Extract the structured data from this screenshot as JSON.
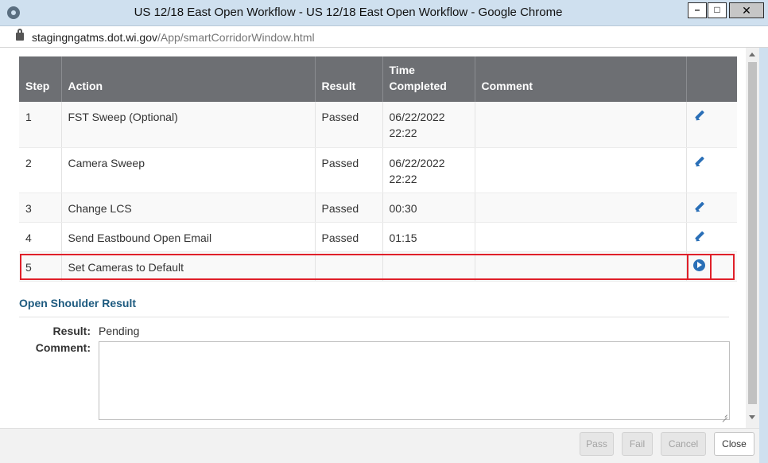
{
  "window": {
    "title": "US 12/18 East Open Workflow - US 12/18 East Open Workflow - Google Chrome",
    "minimize_glyph": "–",
    "maximize_glyph": "□",
    "close_glyph": "✕"
  },
  "address": {
    "host": "stagingngatms.dot.wi.gov",
    "path": "/App/smartCorridorWindow.html"
  },
  "table": {
    "headers": {
      "step": "Step",
      "action": "Action",
      "result": "Result",
      "time_completed_line1": "Time",
      "time_completed_line2": "Completed",
      "comment": "Comment",
      "icon": ""
    },
    "rows": [
      {
        "step": "1",
        "action": "FST Sweep (Optional)",
        "result": "Passed",
        "time_line1": "06/22/2022",
        "time_line2": "22:22",
        "comment": "",
        "icon": "edit-pencil-icon"
      },
      {
        "step": "2",
        "action": "Camera Sweep",
        "result": "Passed",
        "time_line1": "06/22/2022",
        "time_line2": "22:22",
        "comment": "",
        "icon": "edit-pencil-icon"
      },
      {
        "step": "3",
        "action": "Change LCS",
        "result": "Passed",
        "time_line1": "00:30",
        "time_line2": "",
        "comment": "",
        "icon": "edit-pencil-icon"
      },
      {
        "step": "4",
        "action": "Send Eastbound Open Email",
        "result": "Passed",
        "time_line1": "01:15",
        "time_line2": "",
        "comment": "",
        "icon": "edit-pencil-icon"
      },
      {
        "step": "5",
        "action": "Set Cameras to Default",
        "result": "",
        "time_line1": "",
        "time_line2": "",
        "comment": "",
        "icon": "play-circle-icon"
      }
    ]
  },
  "section": {
    "title": "Open Shoulder Result",
    "result_label": "Result:",
    "result_value": "Pending",
    "comment_label": "Comment:",
    "comment_value": ""
  },
  "footer": {
    "pass_label": "Pass",
    "fail_label": "Fail",
    "cancel_label": "Cancel",
    "close_label": "Close"
  },
  "colors": {
    "header_bg": "#6d6f73",
    "accent_blue": "#2a6fb7",
    "highlight_red": "#e0202a",
    "section_title": "#1d5a7f"
  }
}
